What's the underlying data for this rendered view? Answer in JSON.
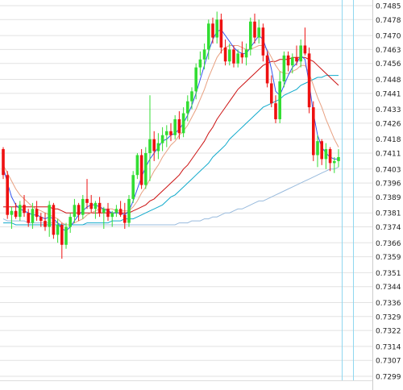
{
  "chart_data": {
    "type": "candlestick",
    "title": "",
    "xlabel": "",
    "ylabel": "",
    "ylim": [
      0.7296,
      0.7488
    ],
    "grid": true,
    "y_ticks": [
      "0.7485",
      "0.7478",
      "0.7470",
      "0.7463",
      "0.7456",
      "0.7448",
      "0.7441",
      "0.7433",
      "0.7426",
      "0.7418",
      "0.7411",
      "0.7403",
      "0.7396",
      "0.7389",
      "0.7381",
      "0.7374",
      "0.7366",
      "0.7359",
      "0.7351",
      "0.7344",
      "0.7336",
      "0.7329",
      "0.7322",
      "0.7314",
      "0.7307",
      "0.7299"
    ],
    "colors": {
      "up": "#33dd33",
      "down": "#ee1111",
      "ma_fast": "#3355ee",
      "ma_mid": "#e8a080",
      "ma_slow": "#cc1111",
      "ma_long": "#11aacc",
      "ma_200": "#99bbdd",
      "grid": "#e2e2e2",
      "vline": "#8fd7f0"
    },
    "candles": [
      [
        0.7413,
        0.7414,
        0.7398,
        0.74
      ],
      [
        0.74,
        0.7402,
        0.7378,
        0.738
      ],
      [
        0.738,
        0.7384,
        0.7373,
        0.7382
      ],
      [
        0.7382,
        0.7386,
        0.7378,
        0.7379
      ],
      [
        0.7379,
        0.7387,
        0.7377,
        0.7385
      ],
      [
        0.7385,
        0.739,
        0.7379,
        0.7381
      ],
      [
        0.7381,
        0.7383,
        0.7374,
        0.7376
      ],
      [
        0.7376,
        0.7386,
        0.7373,
        0.7383
      ],
      [
        0.7383,
        0.7387,
        0.7377,
        0.7379
      ],
      [
        0.7379,
        0.7381,
        0.7374,
        0.7377
      ],
      [
        0.7377,
        0.7381,
        0.7372,
        0.7374
      ],
      [
        0.7374,
        0.7387,
        0.7369,
        0.7385
      ],
      [
        0.7385,
        0.7386,
        0.7368,
        0.737
      ],
      [
        0.737,
        0.7378,
        0.7366,
        0.7375
      ],
      [
        0.7375,
        0.7376,
        0.7358,
        0.7365
      ],
      [
        0.7365,
        0.7376,
        0.7363,
        0.7374
      ],
      [
        0.7374,
        0.7381,
        0.7371,
        0.7379
      ],
      [
        0.7379,
        0.7388,
        0.7376,
        0.7385
      ],
      [
        0.7385,
        0.7386,
        0.7377,
        0.738
      ],
      [
        0.738,
        0.739,
        0.7378,
        0.7388
      ],
      [
        0.7388,
        0.7398,
        0.7383,
        0.7386
      ],
      [
        0.7386,
        0.739,
        0.7381,
        0.7383
      ],
      [
        0.7383,
        0.7387,
        0.7378,
        0.7386
      ],
      [
        0.7386,
        0.7389,
        0.7379,
        0.7381
      ],
      [
        0.7381,
        0.7384,
        0.7373,
        0.7383
      ],
      [
        0.7383,
        0.7386,
        0.7377,
        0.7379
      ],
      [
        0.7379,
        0.7382,
        0.7374,
        0.7381
      ],
      [
        0.7381,
        0.7385,
        0.7379,
        0.7383
      ],
      [
        0.7383,
        0.7387,
        0.7379,
        0.738
      ],
      [
        0.738,
        0.7386,
        0.7373,
        0.7376
      ],
      [
        0.7376,
        0.739,
        0.7374,
        0.7388
      ],
      [
        0.7388,
        0.7402,
        0.7386,
        0.74
      ],
      [
        0.74,
        0.7411,
        0.7398,
        0.741
      ],
      [
        0.741,
        0.7413,
        0.7393,
        0.7395
      ],
      [
        0.7395,
        0.7414,
        0.7393,
        0.7411
      ],
      [
        0.7411,
        0.744,
        0.7397,
        0.7418
      ],
      [
        0.7418,
        0.7422,
        0.7407,
        0.7412
      ],
      [
        0.7412,
        0.7421,
        0.7408,
        0.7416
      ],
      [
        0.7416,
        0.7424,
        0.7412,
        0.742
      ],
      [
        0.742,
        0.7425,
        0.7414,
        0.7422
      ],
      [
        0.7422,
        0.7426,
        0.7417,
        0.742
      ],
      [
        0.742,
        0.743,
        0.7418,
        0.7428
      ],
      [
        0.7428,
        0.7432,
        0.7418,
        0.7421
      ],
      [
        0.7421,
        0.7434,
        0.7419,
        0.7431
      ],
      [
        0.7431,
        0.744,
        0.7427,
        0.7437
      ],
      [
        0.7437,
        0.7444,
        0.7433,
        0.7442
      ],
      [
        0.7442,
        0.7456,
        0.7438,
        0.7454
      ],
      [
        0.7454,
        0.7462,
        0.745,
        0.7458
      ],
      [
        0.7458,
        0.7466,
        0.7453,
        0.7463
      ],
      [
        0.7463,
        0.7478,
        0.7458,
        0.7476
      ],
      [
        0.7476,
        0.7479,
        0.7466,
        0.7469
      ],
      [
        0.7469,
        0.7482,
        0.7466,
        0.7478
      ],
      [
        0.7478,
        0.7481,
        0.7461,
        0.7464
      ],
      [
        0.7464,
        0.7468,
        0.7455,
        0.7457
      ],
      [
        0.7457,
        0.7466,
        0.7455,
        0.7463
      ],
      [
        0.7463,
        0.7465,
        0.7454,
        0.7456
      ],
      [
        0.7456,
        0.7463,
        0.7454,
        0.7461
      ],
      [
        0.7461,
        0.7467,
        0.7456,
        0.7459
      ],
      [
        0.7459,
        0.7466,
        0.7455,
        0.7463
      ],
      [
        0.7463,
        0.7479,
        0.746,
        0.7477
      ],
      [
        0.7477,
        0.7481,
        0.7466,
        0.7469
      ],
      [
        0.7469,
        0.7478,
        0.7466,
        0.7474
      ],
      [
        0.7474,
        0.7476,
        0.7457,
        0.746
      ],
      [
        0.746,
        0.7462,
        0.7444,
        0.7446
      ],
      [
        0.7446,
        0.745,
        0.7434,
        0.7436
      ],
      [
        0.7436,
        0.744,
        0.7426,
        0.7428
      ],
      [
        0.7428,
        0.7452,
        0.7426,
        0.7447
      ],
      [
        0.7447,
        0.7462,
        0.7444,
        0.746
      ],
      [
        0.746,
        0.7462,
        0.7452,
        0.7455
      ],
      [
        0.7455,
        0.7461,
        0.7451,
        0.7459
      ],
      [
        0.7459,
        0.7465,
        0.7455,
        0.7457
      ],
      [
        0.7457,
        0.7468,
        0.7454,
        0.7465
      ],
      [
        0.7465,
        0.7474,
        0.746,
        0.7461
      ],
      [
        0.7461,
        0.7464,
        0.7431,
        0.7434
      ],
      [
        0.7434,
        0.7437,
        0.7407,
        0.741
      ],
      [
        0.741,
        0.742,
        0.7404,
        0.7417
      ],
      [
        0.7417,
        0.7418,
        0.7405,
        0.7408
      ],
      [
        0.7408,
        0.7416,
        0.7403,
        0.7413
      ],
      [
        0.7413,
        0.7414,
        0.7402,
        0.7406
      ],
      [
        0.7406,
        0.7409,
        0.7401,
        0.7407
      ],
      [
        0.7407,
        0.7413,
        0.7404,
        0.7409
      ]
    ],
    "ma_fast": [
      0.7404,
      0.7396,
      0.7389,
      0.7385,
      0.7383,
      0.7382,
      0.7381,
      0.738,
      0.738,
      0.7379,
      0.7378,
      0.7379,
      0.7378,
      0.7376,
      0.7373,
      0.7372,
      0.7374,
      0.7377,
      0.738,
      0.7382,
      0.7384,
      0.7385,
      0.7385,
      0.7384,
      0.7383,
      0.7382,
      0.7381,
      0.7381,
      0.7381,
      0.738,
      0.7382,
      0.7387,
      0.7393,
      0.7399,
      0.7404,
      0.7408,
      0.7411,
      0.7414,
      0.7417,
      0.7418,
      0.742,
      0.7421,
      0.7423,
      0.7426,
      0.743,
      0.7435,
      0.7441,
      0.7448,
      0.7455,
      0.7462,
      0.7468,
      0.7472,
      0.7473,
      0.747,
      0.7467,
      0.7464,
      0.7462,
      0.7461,
      0.7461,
      0.7464,
      0.7467,
      0.747,
      0.7468,
      0.7462,
      0.7453,
      0.7442,
      0.744,
      0.7445,
      0.745,
      0.7454,
      0.7456,
      0.746,
      0.7458,
      0.7446,
      0.7431,
      0.742,
      0.7414,
      0.7411,
      0.7409,
      0.7408,
      0.7408
    ],
    "ma_mid": [
      0.7405,
      0.7401,
      0.7397,
      0.7393,
      0.739,
      0.7388,
      0.7386,
      0.7384,
      0.7383,
      0.7382,
      0.7381,
      0.738,
      0.7379,
      0.7378,
      0.7376,
      0.7375,
      0.7375,
      0.7376,
      0.7377,
      0.7378,
      0.738,
      0.7381,
      0.7382,
      0.7383,
      0.7383,
      0.7383,
      0.7383,
      0.7382,
      0.7382,
      0.7382,
      0.7382,
      0.7384,
      0.7387,
      0.7391,
      0.7394,
      0.7398,
      0.7402,
      0.7405,
      0.7409,
      0.7412,
      0.7415,
      0.7417,
      0.742,
      0.7422,
      0.7425,
      0.7429,
      0.7433,
      0.7438,
      0.7443,
      0.7449,
      0.7454,
      0.7459,
      0.7462,
      0.7464,
      0.7465,
      0.7465,
      0.7465,
      0.7464,
      0.7463,
      0.7463,
      0.7464,
      0.7465,
      0.7465,
      0.7463,
      0.7459,
      0.7455,
      0.7452,
      0.7451,
      0.7451,
      0.7452,
      0.7453,
      0.7455,
      0.7455,
      0.7451,
      0.7445,
      0.7439,
      0.7434,
      0.7428,
      0.7423,
      0.7418,
      0.7414
    ],
    "ma_slow": [
      0.7384,
      0.7384,
      0.7384,
      0.7384,
      0.7384,
      0.7384,
      0.7384,
      0.7384,
      0.7384,
      0.7384,
      0.7384,
      0.7384,
      0.7383,
      0.7383,
      0.7382,
      0.7381,
      0.7381,
      0.7381,
      0.7381,
      0.7381,
      0.7381,
      0.7381,
      0.7381,
      0.7381,
      0.7381,
      0.7381,
      0.7381,
      0.7381,
      0.7381,
      0.7381,
      0.7381,
      0.7382,
      0.7383,
      0.7384,
      0.7385,
      0.7387,
      0.7388,
      0.739,
      0.7392,
      0.7394,
      0.7396,
      0.7398,
      0.74,
      0.7403,
      0.7405,
      0.7408,
      0.7411,
      0.7414,
      0.7417,
      0.7421,
      0.7424,
      0.7428,
      0.7431,
      0.7434,
      0.7437,
      0.744,
      0.7443,
      0.7445,
      0.7447,
      0.7449,
      0.7451,
      0.7453,
      0.7455,
      0.7456,
      0.7457,
      0.7457,
      0.7458,
      0.7458,
      0.7458,
      0.7459,
      0.7459,
      0.7459,
      0.7459,
      0.7458,
      0.7457,
      0.7455,
      0.7453,
      0.7451,
      0.7449,
      0.7447,
      0.7445
    ],
    "ma_long": [
      0.7376,
      0.7376,
      0.7376,
      0.7375,
      0.7375,
      0.7375,
      0.7375,
      0.7375,
      0.7375,
      0.7375,
      0.7375,
      0.7375,
      0.7375,
      0.7375,
      0.7375,
      0.7375,
      0.7375,
      0.7375,
      0.7375,
      0.7375,
      0.7376,
      0.7376,
      0.7376,
      0.7376,
      0.7376,
      0.7376,
      0.7377,
      0.7377,
      0.7377,
      0.7378,
      0.7378,
      0.7378,
      0.7379,
      0.738,
      0.7381,
      0.7382,
      0.7383,
      0.7384,
      0.7385,
      0.7387,
      0.7389,
      0.739,
      0.7392,
      0.7394,
      0.7396,
      0.7398,
      0.74,
      0.7402,
      0.7404,
      0.7406,
      0.7409,
      0.7411,
      0.7413,
      0.7415,
      0.7418,
      0.742,
      0.7422,
      0.7424,
      0.7426,
      0.7428,
      0.743,
      0.7432,
      0.7434,
      0.7435,
      0.7436,
      0.7437,
      0.7438,
      0.744,
      0.7441,
      0.7442,
      0.7443,
      0.7445,
      0.7446,
      0.7447,
      0.7448,
      0.7449,
      0.7449,
      0.745,
      0.745,
      0.745,
      0.745
    ],
    "ma_200": [
      0.7378,
      0.7377,
      0.7377,
      0.7377,
      0.7377,
      0.7377,
      0.7376,
      0.7376,
      0.7376,
      0.7376,
      0.7376,
      0.7376,
      0.7376,
      0.7376,
      0.7375,
      0.7375,
      0.7375,
      0.7375,
      0.7375,
      0.7375,
      0.7375,
      0.7375,
      0.7375,
      0.7375,
      0.7375,
      0.7375,
      0.7375,
      0.7375,
      0.7375,
      0.7375,
      0.7375,
      0.7375,
      0.7375,
      0.7375,
      0.7375,
      0.7375,
      0.7375,
      0.7375,
      0.7375,
      0.7375,
      0.7375,
      0.7375,
      0.7376,
      0.7376,
      0.7376,
      0.7377,
      0.7377,
      0.7377,
      0.7378,
      0.7378,
      0.7379,
      0.7379,
      0.738,
      0.7381,
      0.7381,
      0.7382,
      0.7383,
      0.7383,
      0.7384,
      0.7385,
      0.7386,
      0.7387,
      0.7387,
      0.7388,
      0.7389,
      0.739,
      0.7391,
      0.7392,
      0.7393,
      0.7394,
      0.7395,
      0.7396,
      0.7397,
      0.7398,
      0.7399,
      0.74,
      0.7401,
      0.7402,
      0.7403,
      0.7403,
      0.7404
    ]
  }
}
